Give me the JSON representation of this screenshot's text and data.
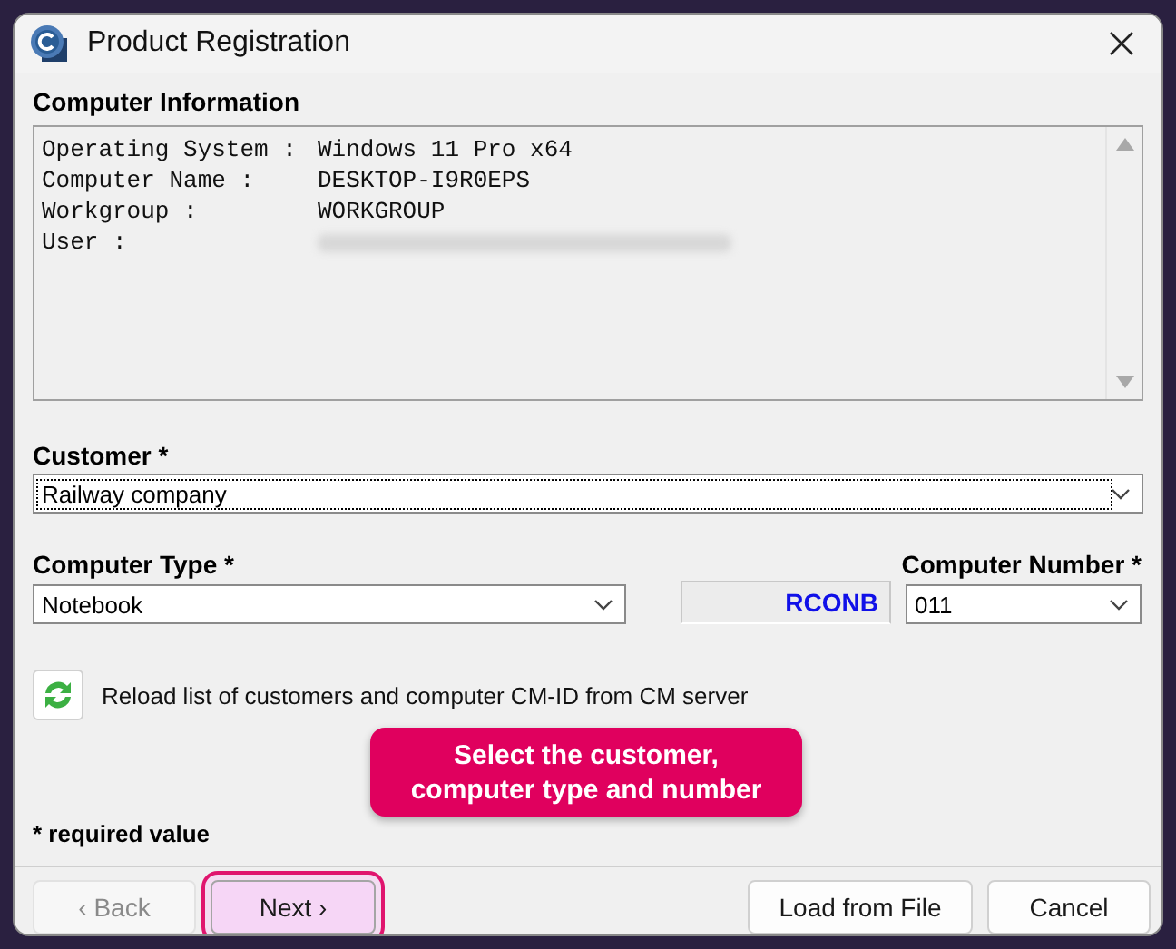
{
  "window": {
    "title": "Product Registration"
  },
  "computer_information": {
    "label": "Computer Information",
    "lines": [
      {
        "label": "Operating System :",
        "value": "Windows 11 Pro x64",
        "redacted": false
      },
      {
        "label": "Computer Name :",
        "value": "DESKTOP-I9R0EPS",
        "redacted": false
      },
      {
        "label": "Workgroup :",
        "value": "WORKGROUP",
        "redacted": false
      },
      {
        "label": "User :",
        "redacted": true
      }
    ]
  },
  "customer": {
    "label": "Customer *",
    "value": "Railway company",
    "focused": true
  },
  "computer_type": {
    "label": "Computer Type *",
    "value": "Notebook",
    "focused": false
  },
  "prefix": {
    "value": "RCONB"
  },
  "computer_number": {
    "label": "Computer Number *",
    "value": "011",
    "focused": false
  },
  "reload": {
    "text": "Reload list of customers and computer CM-ID from CM server"
  },
  "required_note": "* required value",
  "callout": {
    "text": "Select the customer, computer type and number"
  },
  "buttons": [
    {
      "label": "‹ Back",
      "disabled": true,
      "highlighted": false
    },
    {
      "label": "Next ›",
      "disabled": false,
      "highlighted": true
    },
    {
      "label": "Load from File",
      "disabled": false,
      "highlighted": false
    },
    {
      "label": "Cancel",
      "disabled": false,
      "highlighted": false
    }
  ]
}
